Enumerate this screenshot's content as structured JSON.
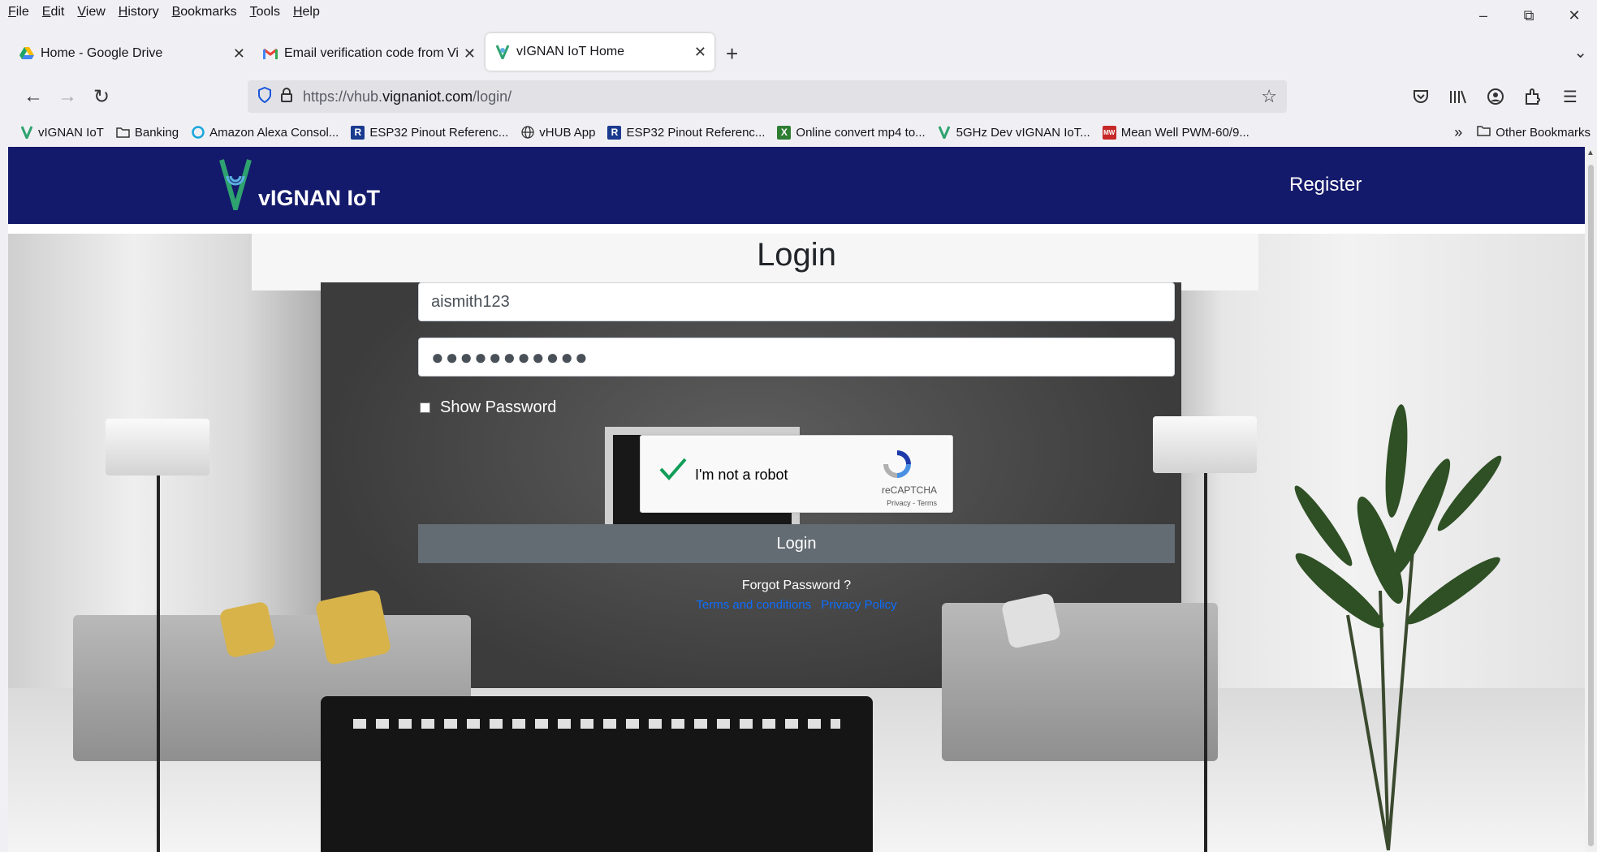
{
  "menu": [
    "File",
    "Edit",
    "View",
    "History",
    "Bookmarks",
    "Tools",
    "Help"
  ],
  "window_controls": {
    "minimize": "–",
    "restore": "⧉",
    "close": "✕"
  },
  "tabs": [
    {
      "label": "Home - Google Drive",
      "icon": "google-drive-icon"
    },
    {
      "label": "Email verification code from Vi",
      "icon": "gmail-icon"
    },
    {
      "label": "vIGNAN IoT Home",
      "icon": "vignan-icon",
      "active": true
    }
  ],
  "nav": {
    "url_prefix": "https://vhub.",
    "url_host": "vignaniot.com",
    "url_path": "/login/"
  },
  "bookmarks": [
    {
      "label": "vIGNAN IoT",
      "icon": "vignan-icon"
    },
    {
      "label": "Banking",
      "icon": "folder-icon"
    },
    {
      "label": "Amazon Alexa Consol...",
      "icon": "alexa-icon"
    },
    {
      "label": "ESP32 Pinout Referenc...",
      "icon": "r-icon"
    },
    {
      "label": "vHUB App",
      "icon": "globe-icon"
    },
    {
      "label": "ESP32 Pinout Referenc...",
      "icon": "r-icon"
    },
    {
      "label": "Online convert mp4 to...",
      "icon": "converter-icon"
    },
    {
      "label": "5GHz Dev vIGNAN IoT...",
      "icon": "vignan-icon"
    },
    {
      "label": "Mean Well PWM-60/9...",
      "icon": "meanwell-icon"
    }
  ],
  "other_bookmarks": "Other Bookmarks",
  "site": {
    "brand": "vIGNAN IoT",
    "register": "Register",
    "title": "Login",
    "username": "aismith123",
    "password_mask": "●●●●●●●●●●●",
    "show_password": "Show Password",
    "captcha": {
      "text": "I'm not a robot",
      "brand": "reCAPTCHA",
      "terms": "Privacy - Terms"
    },
    "login_button": "Login",
    "forgot": "Forgot Password ?",
    "terms": "Terms and conditions",
    "privacy": "Privacy Policy"
  },
  "colors": {
    "header": "#141a6b",
    "login_button": "#636b73",
    "link": "#0d6efd"
  }
}
